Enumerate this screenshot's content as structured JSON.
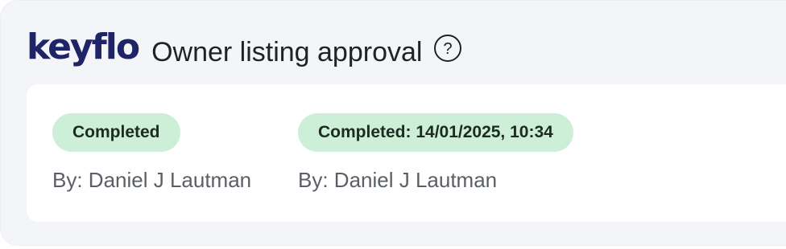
{
  "header": {
    "logo_text": "keyflo",
    "title": "Owner listing approval",
    "help_icon": "help-circle-icon"
  },
  "approvals": [
    {
      "status_label": "Completed",
      "by_label": "By: Daniel J Lautman"
    },
    {
      "status_label": "Completed: 14/01/2025, 10:34",
      "by_label": "By: Daniel J Lautman"
    }
  ],
  "colors": {
    "brand": "#1e2466",
    "badge_bg": "#cdeed7",
    "panel_bg": "#f4f5f8"
  }
}
